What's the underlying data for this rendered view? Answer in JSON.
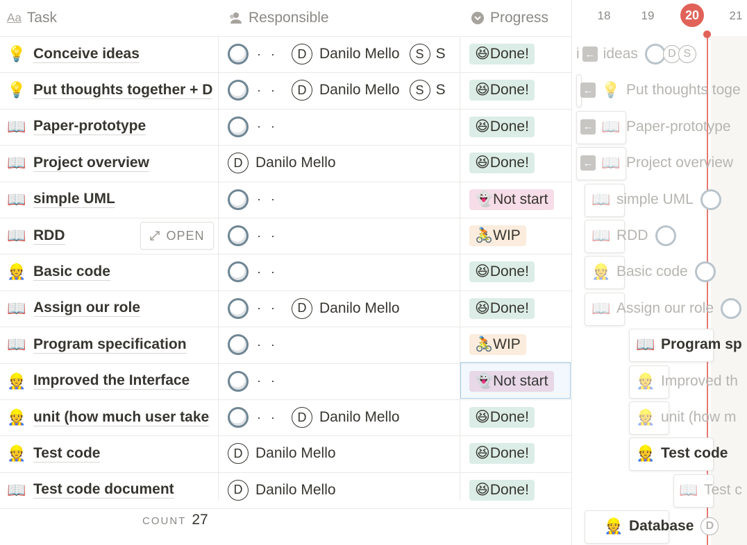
{
  "columns": {
    "task": {
      "label": "Task",
      "icon": "text-property-icon"
    },
    "responsible": {
      "label": "Responsible",
      "icon": "person-property-icon"
    },
    "progress": {
      "label": "Progress",
      "icon": "select-property-icon"
    }
  },
  "rows": [
    {
      "icon": "💡",
      "title": "Conceive ideas",
      "people": [
        "egg",
        "dots",
        "Danilo Mello",
        "S"
      ],
      "progress": "Done!"
    },
    {
      "icon": "💡",
      "title": "Put thoughts together + D",
      "people": [
        "egg",
        "dots",
        "Danilo Mello",
        "S"
      ],
      "progress": "Done!"
    },
    {
      "icon": "📖",
      "title": "Paper-prototype",
      "people": [
        "egg",
        "dots"
      ],
      "progress": "Done!"
    },
    {
      "icon": "📖",
      "title": "Project overview",
      "people": [
        "Danilo Mello"
      ],
      "progress": "Done!"
    },
    {
      "icon": "📖",
      "title": "simple UML",
      "people": [
        "egg",
        "dots"
      ],
      "progress": "Not start"
    },
    {
      "icon": "📖",
      "title": "RDD",
      "people": [
        "egg",
        "dots"
      ],
      "progress": "WIP"
    },
    {
      "icon": "👷",
      "title": "Basic code",
      "people": [
        "egg",
        "dots"
      ],
      "progress": "Done!"
    },
    {
      "icon": "📖",
      "title": "Assign our role",
      "people": [
        "egg",
        "dots",
        "Danilo Mello"
      ],
      "progress": "Done!"
    },
    {
      "icon": "📖",
      "title": "Program specification",
      "people": [
        "egg",
        "dots"
      ],
      "progress": "WIP"
    },
    {
      "icon": "👷",
      "title": "Improved the Interface",
      "people": [
        "egg",
        "dots"
      ],
      "progress": "Not start"
    },
    {
      "icon": "👷",
      "title": "unit (how much user take",
      "people": [
        "egg",
        "dots",
        "Danilo Mello"
      ],
      "progress": "Done!"
    },
    {
      "icon": "👷",
      "title": "Test code",
      "people": [
        "Danilo Mello"
      ],
      "progress": "Done!"
    },
    {
      "icon": "📖",
      "title": "Test code document",
      "people": [
        "Danilo Mello"
      ],
      "progress": "Done!"
    }
  ],
  "progress_emoji": {
    "Done!": "😆",
    "Not start": "👻",
    "WIP": "🚴"
  },
  "open_button": {
    "label": "OPEN"
  },
  "footer": {
    "count_label": "COUNT",
    "count_value": "27"
  },
  "timeline": {
    "days": [
      "18",
      "19",
      "20",
      "21"
    ],
    "today": "20",
    "items": [
      {
        "text": "ideas",
        "prefix": "i",
        "arrow": true
      },
      {
        "text": "Put thoughts toge",
        "icon": "💡",
        "arrow": true
      },
      {
        "text": "Paper-prototype",
        "icon": "📖",
        "arrow": true
      },
      {
        "text": "Project overview",
        "icon": "📖",
        "arrow": true
      },
      {
        "text": "simple UML",
        "icon": "📖"
      },
      {
        "text": "RDD",
        "icon": "📖"
      },
      {
        "text": "Basic code",
        "icon": "👷"
      },
      {
        "text": "Assign our role",
        "icon": "📖"
      },
      {
        "text": "Program sp",
        "icon": "📖"
      },
      {
        "text": "Improved th",
        "icon": "👷"
      },
      {
        "text": "unit (how m",
        "icon": "👷"
      },
      {
        "text": "Test code",
        "icon": "👷"
      },
      {
        "text": "Test c",
        "icon": "📖"
      },
      {
        "text": "Database",
        "icon": "👷"
      }
    ]
  },
  "colors": {
    "today": "#e16259",
    "done": "#dbede6",
    "not_start": "#f6dde8",
    "wip": "#fbecdd",
    "selection": "#a6cce8"
  }
}
